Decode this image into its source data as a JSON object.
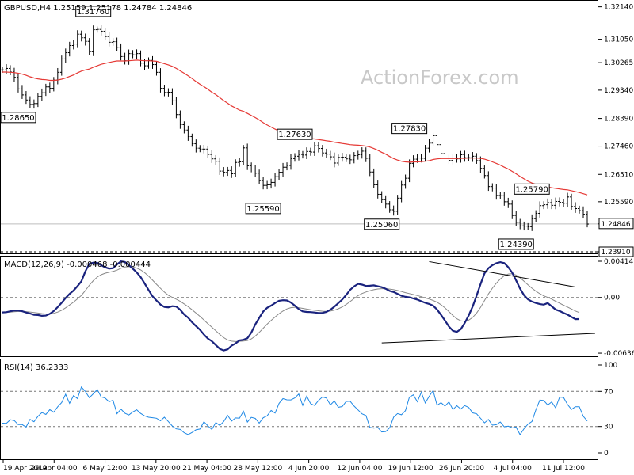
{
  "header": {
    "price_title": "GBPUSD,H4  1.25159 1.25178 1.24784 1.24846",
    "macd_title": "MACD(12,26,9) -0.000468 -0.000444",
    "rsi_title": "RSI(14) 36.2333",
    "watermark": "ActionForex.com"
  },
  "colors": {
    "candles": "#000000",
    "ma": "#e53935",
    "macd": "#1a237e",
    "signal": "#888888",
    "rsi": "#1e88e5",
    "grid": "#bdbdbd"
  },
  "chart_data": {
    "type": "line",
    "x_labels": [
      "19 Apr 2019",
      "29 Apr 04:00",
      "6 May 12:00",
      "13 May 20:00",
      "21 May 04:00",
      "28 May 12:00",
      "4 Jun 20:00",
      "12 Jun 04:00",
      "19 Jun 12:00",
      "26 Jun 20:00",
      "4 Jul 04:00",
      "11 Jul 12:00"
    ],
    "price_pane": {
      "ylim": [
        1.2391,
        1.3221
      ],
      "ticks": [
        "1.32140",
        "1.31050",
        "1.30265",
        "1.29340",
        "1.28390",
        "1.27460",
        "1.26510",
        "1.25590",
        "1.24846",
        "1.23910"
      ],
      "annotations": [
        {
          "text": "1.31760",
          "bar": 23,
          "value": 1.3176
        },
        {
          "text": "1.28650",
          "bar": 0,
          "value": 1.2865
        },
        {
          "text": "1.27630",
          "bar": 74,
          "value": 1.2763
        },
        {
          "text": "1.25590",
          "bar": 66,
          "value": 1.2559
        },
        {
          "text": "1.27830",
          "bar": 103,
          "value": 1.2783
        },
        {
          "text": "1.25060",
          "bar": 96,
          "value": 1.2506
        },
        {
          "text": "1.25790",
          "bar": 134,
          "value": 1.2579
        },
        {
          "text": "1.24390",
          "bar": 130,
          "value": 1.2439
        }
      ],
      "current_price": "1.24846",
      "support": "1.23910",
      "close": [
        1.3002,
        1.3007,
        1.2995,
        1.2977,
        1.2938,
        1.2918,
        1.2901,
        1.2886,
        1.2889,
        1.2913,
        1.2925,
        1.2945,
        1.294,
        1.2968,
        1.2994,
        1.3039,
        1.306,
        1.3084,
        1.3089,
        1.3122,
        1.311,
        1.3098,
        1.3063,
        1.3137,
        1.3138,
        1.3132,
        1.3114,
        1.3095,
        1.3097,
        1.3078,
        1.3047,
        1.3033,
        1.3057,
        1.3053,
        1.3057,
        1.3025,
        1.3016,
        1.3034,
        1.302,
        1.2994,
        1.294,
        1.2926,
        1.2927,
        1.2898,
        1.2852,
        1.2818,
        1.28,
        1.2778,
        1.2754,
        1.2739,
        1.2736,
        1.2736,
        1.2718,
        1.2703,
        1.2695,
        1.2662,
        1.2658,
        1.2664,
        1.2653,
        1.2691,
        1.2693,
        1.274,
        1.268,
        1.2669,
        1.2655,
        1.263,
        1.2614,
        1.2616,
        1.2624,
        1.2643,
        1.2658,
        1.2675,
        1.2681,
        1.2704,
        1.2712,
        1.2718,
        1.2716,
        1.2728,
        1.2726,
        1.2747,
        1.2738,
        1.2723,
        1.2719,
        1.271,
        1.2689,
        1.2708,
        1.2709,
        1.2703,
        1.27,
        1.2714,
        1.2717,
        1.2729,
        1.2705,
        1.2659,
        1.2616,
        1.2584,
        1.2566,
        1.2551,
        1.2532,
        1.2527,
        1.2571,
        1.2615,
        1.2638,
        1.2688,
        1.2702,
        1.2706,
        1.2705,
        1.2739,
        1.2756,
        1.2781,
        1.2751,
        1.2721,
        1.2705,
        1.2698,
        1.2706,
        1.2703,
        1.2717,
        1.2707,
        1.2707,
        1.2712,
        1.2697,
        1.2671,
        1.2647,
        1.261,
        1.2605,
        1.258,
        1.2579,
        1.2559,
        1.2551,
        1.2513,
        1.249,
        1.2478,
        1.2477,
        1.2475,
        1.2502,
        1.252,
        1.2546,
        1.2549,
        1.2556,
        1.2547,
        1.256,
        1.2557,
        1.2554,
        1.2575,
        1.2543,
        1.2536,
        1.2529,
        1.2517,
        1.2484
      ],
      "ma": [
        1.2995,
        1.2995,
        1.2994,
        1.2993,
        1.2991,
        1.2988,
        1.2984,
        1.2979,
        1.2975,
        1.2972,
        1.297,
        1.2969,
        1.2967,
        1.2967,
        1.2968,
        1.2971,
        1.2975,
        1.298,
        1.2985,
        1.2992,
        1.2998,
        1.3002,
        1.3005,
        1.3011,
        1.3016,
        1.3021,
        1.3024,
        1.3027,
        1.303,
        1.3032,
        1.3032,
        1.3032,
        1.3033,
        1.3034,
        1.3035,
        1.3034,
        1.3033,
        1.3033,
        1.3032,
        1.3031,
        1.3027,
        1.3023,
        1.3019,
        1.3014,
        1.3007,
        1.2999,
        1.2991,
        1.2982,
        1.2973,
        1.2963,
        1.2954,
        1.2946,
        1.2937,
        1.2927,
        1.2919,
        1.2909,
        1.2899,
        1.289,
        1.2881,
        1.2874,
        1.2867,
        1.2863,
        1.2856,
        1.2849,
        1.2842,
        1.2834,
        1.2825,
        1.2817,
        1.281,
        1.2803,
        1.2797,
        1.2792,
        1.2787,
        1.2784,
        1.2781,
        1.2778,
        1.2775,
        1.2773,
        1.2771,
        1.277,
        1.2768,
        1.2766,
        1.2764,
        1.2762,
        1.2759,
        1.2757,
        1.2755,
        1.2753,
        1.2751,
        1.275,
        1.2749,
        1.2748,
        1.2746,
        1.2743,
        1.2738,
        1.2732,
        1.2725,
        1.2719,
        1.2711,
        1.2704,
        1.2699,
        1.2695,
        1.2693,
        1.2692,
        1.2693,
        1.2693,
        1.2694,
        1.2695,
        1.2697,
        1.2701,
        1.2703,
        1.2704,
        1.2704,
        1.2704,
        1.2704,
        1.2704,
        1.2705,
        1.2705,
        1.2706,
        1.2706,
        1.2706,
        1.2705,
        1.2702,
        1.2698,
        1.2693,
        1.2688,
        1.2682,
        1.2675,
        1.2669,
        1.2661,
        1.2653,
        1.2644,
        1.2636,
        1.2628,
        1.2622,
        1.2617,
        1.2614,
        1.2611,
        1.2609,
        1.2606,
        1.2604,
        1.2602,
        1.26,
        1.2599,
        1.2596,
        1.2593,
        1.259,
        1.2586,
        1.2582
      ]
    },
    "macd_pane": {
      "ylim": [
        -0.00636,
        0.00414
      ],
      "ticks": [
        "0.004141",
        "0.00",
        "-0.006365"
      ],
      "macd": [
        -0.00171,
        -0.00168,
        -0.00158,
        -0.00149,
        -0.0015,
        -0.00157,
        -0.00172,
        -0.00183,
        -0.00198,
        -0.00201,
        -0.0021,
        -0.00207,
        -0.00187,
        -0.00155,
        -0.0011,
        -0.0006,
        -6e-05,
        0.00041,
        0.0008,
        0.00129,
        0.00185,
        0.00298,
        0.00384,
        0.00399,
        0.00396,
        0.00369,
        0.00345,
        0.00331,
        0.00335,
        0.00378,
        0.00412,
        0.00406,
        0.00371,
        0.00329,
        0.00287,
        0.00233,
        0.00161,
        0.00085,
        0.00013,
        -0.00035,
        -0.00081,
        -0.00108,
        -0.00113,
        -0.00099,
        -0.00104,
        -0.00141,
        -0.00194,
        -0.00231,
        -0.00284,
        -0.00326,
        -0.00369,
        -0.00423,
        -0.0047,
        -0.005,
        -0.00544,
        -0.00587,
        -0.00605,
        -0.00593,
        -0.00551,
        -0.00526,
        -0.0049,
        -0.00484,
        -0.00466,
        -0.00402,
        -0.00308,
        -0.00233,
        -0.00161,
        -0.00118,
        -0.00093,
        -0.00063,
        -0.00038,
        -0.00031,
        -0.00034,
        -0.00058,
        -0.00093,
        -0.00133,
        -0.00159,
        -0.00165,
        -0.00167,
        -0.00172,
        -0.00177,
        -0.00176,
        -0.00165,
        -0.0014,
        -0.00106,
        -0.00064,
        -0.00024,
        0.00029,
        0.00087,
        0.00127,
        0.00155,
        0.00147,
        0.00132,
        0.00134,
        0.00139,
        0.00128,
        0.00118,
        0.001,
        0.00075,
        0.00063,
        0.00042,
        0.00019,
        8e-05,
        1e-05,
        -0.00011,
        -0.00024,
        -0.00043,
        -0.00061,
        -0.00074,
        -0.00094,
        -0.00138,
        -0.00199,
        -0.00264,
        -0.00333,
        -0.00381,
        -0.00393,
        -0.00363,
        -0.00292,
        -0.00206,
        -0.00104,
        0.00021,
        0.00153,
        0.00276,
        0.00334,
        0.0037,
        0.00392,
        0.00404,
        0.00393,
        0.00346,
        0.00284,
        0.00196,
        0.00102,
        0.00027,
        -0.00021,
        -0.00047,
        -0.00063,
        -0.00076,
        -0.00082,
        -0.00064,
        -0.00101,
        -0.00138,
        -0.00154,
        -0.00176,
        -0.00196,
        -0.00222,
        -0.00248,
        -0.00247
      ],
      "signal": [
        -0.0017,
        -0.00169,
        -0.00167,
        -0.00163,
        -0.0016,
        -0.00159,
        -0.00162,
        -0.00166,
        -0.00172,
        -0.00178,
        -0.00184,
        -0.00189,
        -0.00188,
        -0.00182,
        -0.00167,
        -0.00146,
        -0.00118,
        -0.00086,
        -0.00053,
        -0.00016,
        0.00024,
        0.00079,
        0.0014,
        0.00192,
        0.00233,
        0.0026,
        0.00277,
        0.00288,
        0.00297,
        0.00313,
        0.00333,
        0.00348,
        0.00353,
        0.00348,
        0.00336,
        0.00315,
        0.00284,
        0.00244,
        0.00198,
        0.00151,
        0.00104,
        0.00062,
        0.00026,
        1e-05,
        -0.0002,
        -0.00044,
        -0.00074,
        -0.00105,
        -0.00141,
        -0.00178,
        -0.00216,
        -0.00257,
        -0.003,
        -0.0034,
        -0.00381,
        -0.00422,
        -0.00459,
        -0.00486,
        -0.00499,
        -0.00504,
        -0.00501,
        -0.00498,
        -0.00492,
        -0.00474,
        -0.00441,
        -0.00399,
        -0.00352,
        -0.00305,
        -0.00263,
        -0.00223,
        -0.00186,
        -0.00155,
        -0.00131,
        -0.00116,
        -0.00112,
        -0.00116,
        -0.00125,
        -0.00133,
        -0.0014,
        -0.00146,
        -0.00152,
        -0.00157,
        -0.00158,
        -0.00155,
        -0.00145,
        -0.00129,
        -0.00108,
        -0.0008,
        -0.00047,
        -0.00012,
        0.00021,
        0.00046,
        0.00063,
        0.00077,
        0.00089,
        0.00097,
        0.00101,
        0.00101,
        0.00096,
        0.00089,
        0.0008,
        0.00068,
        0.00056,
        0.00045,
        0.00034,
        0.00022,
        9e-05,
        -5e-05,
        -0.00018,
        -0.00034,
        -0.00054,
        -0.00083,
        -0.00119,
        -0.00162,
        -0.00206,
        -0.00243,
        -0.00267,
        -0.00272,
        -0.00259,
        -0.00228,
        -0.00178,
        -0.00112,
        -0.00034,
        0.0004,
        0.00106,
        0.00163,
        0.00211,
        0.00248,
        0.00268,
        0.00271,
        0.00256,
        0.00225,
        0.00185,
        0.00144,
        0.00106,
        0.00072,
        0.00043,
        0.00018,
        1e-05,
        -0.00019,
        -0.00043,
        -0.00065,
        -0.00088,
        -0.00109,
        -0.00132,
        -0.00154,
        -0.00173
      ],
      "trendlines": [
        {
          "from": [
            108,
            0.0041
          ],
          "to": [
            145,
            0.0012
          ]
        },
        {
          "from": [
            96,
            -0.0052
          ],
          "to": [
            150,
            -0.0041
          ]
        }
      ]
    },
    "rsi_pane": {
      "ylim": [
        0,
        100
      ],
      "ticks": [
        "100",
        "70",
        "30",
        "0"
      ],
      "levels": [
        70,
        30
      ],
      "rsi": [
        33.8,
        33.6,
        37.7,
        36.8,
        32.2,
        32.2,
        29.4,
        38.1,
        35.4,
        41.6,
        45.9,
        43.7,
        49.2,
        46.2,
        52.4,
        57.2,
        66.7,
        56.4,
        65.2,
        61.8,
        75.0,
        69.9,
        62.8,
        67.2,
        72.2,
        63.7,
        62.4,
        58.2,
        59.9,
        44.5,
        49.7,
        45.1,
        43.1,
        46.6,
        49.0,
        44.9,
        42.1,
        40.5,
        40.0,
        39.4,
        36.5,
        40.5,
        35.7,
        30.5,
        27.3,
        26.7,
        22.9,
        20.8,
        23.2,
        26.2,
        27.1,
        35.4,
        30.7,
        26.6,
        34.5,
        31.3,
        35.6,
        42.7,
        36.1,
        39.7,
        39.5,
        47.4,
        35.0,
        40.4,
        39.2,
        33.9,
        39.9,
        42.2,
        48.3,
        45.2,
        56.3,
        61.7,
        60.4,
        60.3,
        62.5,
        66.9,
        54.0,
        64.6,
        56.0,
        54.0,
        59.6,
        63.6,
        62.3,
        54.6,
        59.1,
        51.9,
        52.7,
        58.5,
        58.7,
        53.2,
        48.8,
        44.4,
        42.4,
        29.0,
        28.2,
        28.9,
        23.8,
        24.2,
        28.6,
        40.6,
        44.7,
        43.3,
        48.0,
        63.4,
        66.0,
        58.2,
        68.9,
        56.8,
        64.3,
        70.9,
        54.1,
        57.1,
        53.2,
        57.9,
        49.3,
        53.7,
        49.9,
        53.8,
        51.6,
        45.5,
        44.4,
        39.3,
        34.1,
        37.9,
        31.5,
        32.1,
        35.1,
        29.6,
        30.4,
        28.4,
        29.3,
        20.7,
        27.5,
        32.7,
        35.7,
        49.0,
        60.1,
        59.6,
        54.4,
        57.9,
        51.2,
        63.4,
        63.1,
        55.0,
        49.4,
        52.4,
        52.4,
        41.6,
        36.2
      ]
    }
  }
}
